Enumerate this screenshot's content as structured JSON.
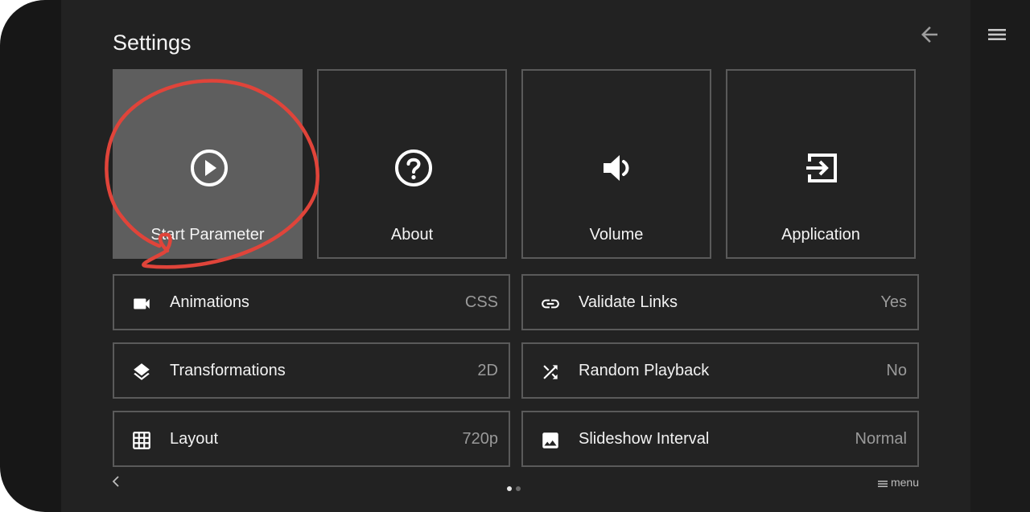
{
  "header": {
    "title": "Settings"
  },
  "tiles": [
    {
      "label": "Start Parameter",
      "icon": "play-circle-icon",
      "active": true
    },
    {
      "label": "About",
      "icon": "help-circle-icon"
    },
    {
      "label": "Volume",
      "icon": "volume-icon"
    },
    {
      "label": "Application",
      "icon": "exit-app-icon"
    }
  ],
  "rows": [
    {
      "label": "Animations",
      "value": "CSS",
      "icon": "video-camera-icon"
    },
    {
      "label": "Validate Links",
      "value": "Yes",
      "icon": "link-icon"
    },
    {
      "label": "Transformations",
      "value": "2D",
      "icon": "layers-icon"
    },
    {
      "label": "Random Playback",
      "value": "No",
      "icon": "shuffle-icon"
    },
    {
      "label": "Layout",
      "value": "720p",
      "icon": "grid-icon"
    },
    {
      "label": "Slideshow Interval",
      "value": "Normal",
      "icon": "image-icon"
    }
  ],
  "footer": {
    "menu_label": "menu",
    "page": 1,
    "page_count": 2
  },
  "colors": {
    "background": "#222222",
    "active_tile": "#5e5e5e",
    "border": "#5a5a5a",
    "annotation": "#e0443a"
  }
}
